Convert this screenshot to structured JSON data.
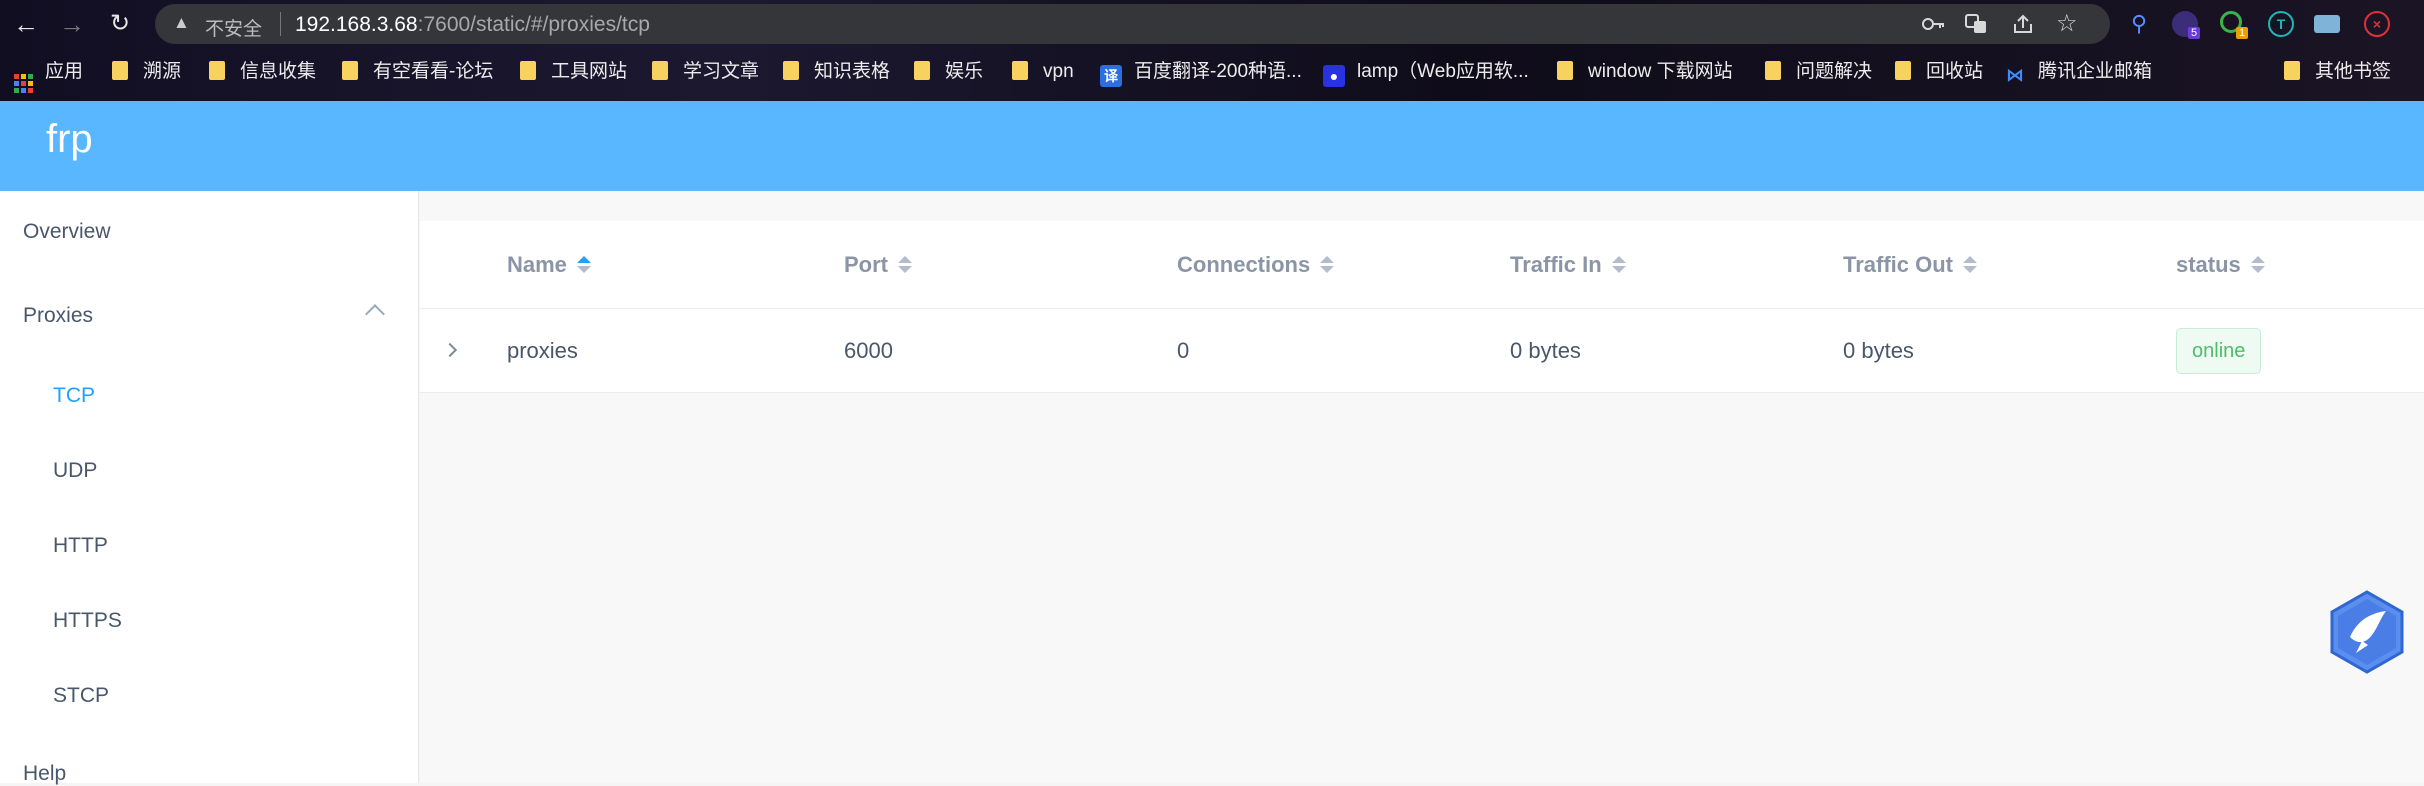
{
  "browser": {
    "insecure_label": "不安全",
    "url_host": "192.168.3.68",
    "url_path": ":7600/static/#/proxies/tcp",
    "extension_badges": [
      "5",
      "1"
    ],
    "bookmarks": [
      {
        "label": "应用",
        "icon": "apps-grid-icon"
      },
      {
        "label": "溯源",
        "icon": "folder-icon"
      },
      {
        "label": "信息收集",
        "icon": "folder-icon"
      },
      {
        "label": "有空看看-论坛",
        "icon": "folder-icon"
      },
      {
        "label": "工具网站",
        "icon": "folder-icon"
      },
      {
        "label": "学习文章",
        "icon": "folder-icon"
      },
      {
        "label": "知识表格",
        "icon": "folder-icon"
      },
      {
        "label": "娱乐",
        "icon": "folder-icon"
      },
      {
        "label": "vpn",
        "icon": "folder-icon"
      },
      {
        "label": "百度翻译-200种语...",
        "icon": "translate-favicon"
      },
      {
        "label": "lamp（Web应用软...",
        "icon": "baidu-favicon"
      },
      {
        "label": "window 下载网站",
        "icon": "folder-icon"
      },
      {
        "label": "问题解决",
        "icon": "folder-icon"
      },
      {
        "label": "回收站",
        "icon": "folder-icon"
      },
      {
        "label": "腾讯企业邮箱",
        "icon": "tencent-mail-favicon"
      },
      {
        "label": "其他书签",
        "icon": "folder-icon"
      }
    ]
  },
  "app": {
    "brand": "frp"
  },
  "sidebar": {
    "overview": "Overview",
    "proxies": "Proxies",
    "sub_items": [
      "TCP",
      "UDP",
      "HTTP",
      "HTTPS",
      "STCP"
    ],
    "active": "TCP",
    "help": "Help"
  },
  "table": {
    "columns": [
      "Name",
      "Port",
      "Connections",
      "Traffic In",
      "Traffic Out",
      "status"
    ],
    "rows": [
      {
        "name": "proxies",
        "port": "6000",
        "connections": "0",
        "traffic_in": "0 bytes",
        "traffic_out": "0 bytes",
        "status": "online"
      }
    ]
  },
  "colors": {
    "header": "#58b7ff",
    "active": "#20a0ff",
    "online_text": "#4bbd6b"
  }
}
